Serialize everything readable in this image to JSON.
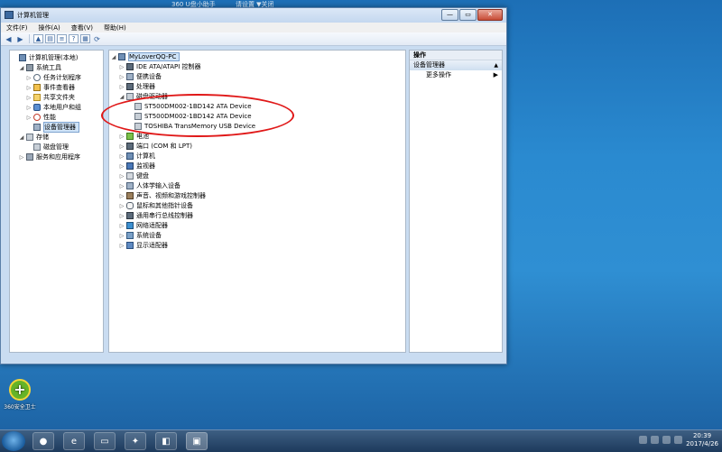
{
  "desktop_top_text": [
    "360 U盘小助手",
    "请设置 ▼关闭"
  ],
  "window": {
    "title": "计算机管理",
    "controls": {
      "minimize": "—",
      "maximize": "▭",
      "close": "✕"
    }
  },
  "menu": [
    "文件(F)",
    "操作(A)",
    "查看(V)",
    "帮助(H)"
  ],
  "toolbar": [
    "back-arrow",
    "forward-arrow",
    "up-folder",
    "show-tree",
    "properties",
    "help",
    "refresh",
    "scan"
  ],
  "left_tree": [
    {
      "label": "计算机管理(本地)",
      "icon": "computer-icon",
      "indent": 0,
      "expander": ""
    },
    {
      "label": "系统工具",
      "icon": "tools-icon",
      "indent": 1,
      "expander": "◢"
    },
    {
      "label": "任务计划程序",
      "icon": "clock-icon",
      "indent": 2,
      "expander": "▷"
    },
    {
      "label": "事件查看器",
      "icon": "event-log-icon",
      "indent": 2,
      "expander": "▷"
    },
    {
      "label": "共享文件夹",
      "icon": "folder-icon",
      "indent": 2,
      "expander": "▷"
    },
    {
      "label": "本地用户和组",
      "icon": "users-icon",
      "indent": 2,
      "expander": "▷"
    },
    {
      "label": "性能",
      "icon": "performance-icon",
      "indent": 2,
      "expander": "▷"
    },
    {
      "label": "设备管理器",
      "icon": "device-manager-icon",
      "indent": 2,
      "expander": "",
      "selected": true
    },
    {
      "label": "存储",
      "icon": "storage-icon",
      "indent": 1,
      "expander": "◢"
    },
    {
      "label": "磁盘管理",
      "icon": "disk-icon",
      "indent": 2,
      "expander": ""
    },
    {
      "label": "服务和应用程序",
      "icon": "services-icon",
      "indent": 1,
      "expander": "▷"
    }
  ],
  "device_tree": [
    {
      "label": "MyLoverQQ-PC",
      "icon": "computer-icon",
      "indent": 0,
      "expander": "◢",
      "root": true
    },
    {
      "label": "IDE ATA/ATAPI 控制器",
      "icon": "chip-icon",
      "indent": 1,
      "expander": "▷"
    },
    {
      "label": "便携设备",
      "icon": "device-icon",
      "indent": 1,
      "expander": "▷"
    },
    {
      "label": "处理器",
      "icon": "chip-icon",
      "indent": 1,
      "expander": "▷"
    },
    {
      "label": "磁盘驱动器",
      "icon": "disk-icon",
      "indent": 1,
      "expander": "◢"
    },
    {
      "label": "ST500DM002-1BD142 ATA Device",
      "icon": "disk-icon",
      "indent": 2,
      "expander": ""
    },
    {
      "label": "ST500DM002-1BD142 ATA Device",
      "icon": "disk-icon",
      "indent": 2,
      "expander": ""
    },
    {
      "label": "TOSHIBA TransMemory USB Device",
      "icon": "disk-icon",
      "indent": 2,
      "expander": ""
    },
    {
      "label": "电池",
      "icon": "battery-icon",
      "indent": 1,
      "expander": "▷"
    },
    {
      "label": "端口 (COM 和 LPT)",
      "icon": "port-icon",
      "indent": 1,
      "expander": "▷"
    },
    {
      "label": "计算机",
      "icon": "computer-icon",
      "indent": 1,
      "expander": "▷"
    },
    {
      "label": "监视器",
      "icon": "monitor-icon",
      "indent": 1,
      "expander": "▷"
    },
    {
      "label": "键盘",
      "icon": "keyboard-icon",
      "indent": 1,
      "expander": "▷"
    },
    {
      "label": "人体学输入设备",
      "icon": "hid-icon",
      "indent": 1,
      "expander": "▷"
    },
    {
      "label": "声音、视频和游戏控制器",
      "icon": "speaker-icon",
      "indent": 1,
      "expander": "▷"
    },
    {
      "label": "鼠标和其他指针设备",
      "icon": "mouse-icon",
      "indent": 1,
      "expander": "▷"
    },
    {
      "label": "通用串行总线控制器",
      "icon": "usb-icon",
      "indent": 1,
      "expander": "▷"
    },
    {
      "label": "网络适配器",
      "icon": "network-icon",
      "indent": 1,
      "expander": "▷"
    },
    {
      "label": "系统设备",
      "icon": "system-device-icon",
      "indent": 1,
      "expander": "▷"
    },
    {
      "label": "显示适配器",
      "icon": "display-adapter-icon",
      "indent": 1,
      "expander": "▷"
    }
  ],
  "actions": {
    "header": "操作",
    "section": "设备管理器",
    "item": "更多操作"
  },
  "desktop_icon": {
    "label": "360安全卫士",
    "icon": "360-safe-icon"
  },
  "taskbar": {
    "apps": [
      "360-browser-icon",
      "ie-icon",
      "explorer-icon",
      "hao123-icon",
      "photo-viewer-icon",
      "computer-management-icon"
    ],
    "clock_time": "20:39",
    "clock_date": "2017/4/26"
  }
}
